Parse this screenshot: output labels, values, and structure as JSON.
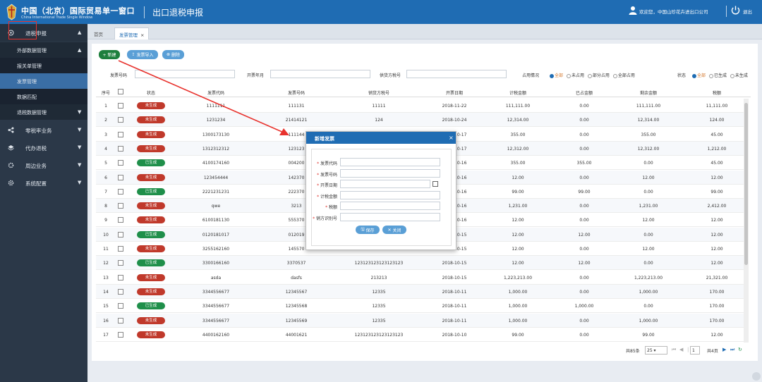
{
  "header": {
    "brand": "中国（北京）国际贸易单一窗口",
    "brand_sub": "China International Trade Single Window",
    "module": "出口退税申报",
    "welcome": "欢迎您，中国山珍花卉进出口公司",
    "logout": "退出"
  },
  "sidebar": {
    "items": [
      {
        "label": "退税申报",
        "icon": "settings-icon"
      },
      {
        "label": "外部数据管理"
      },
      {
        "label": "报关单管理"
      },
      {
        "label": "发票管理"
      },
      {
        "label": "数据匹配"
      },
      {
        "label": "退税数据管理"
      },
      {
        "label": "零税率业务",
        "icon": "share-icon"
      },
      {
        "label": "代办退税",
        "icon": "layers-icon"
      },
      {
        "label": "周边业务",
        "icon": "settings-icon"
      },
      {
        "label": "系统配置",
        "icon": "gear-icon"
      }
    ]
  },
  "tabs": {
    "home": "首页",
    "active": "发票管理"
  },
  "toolbar": {
    "add": "+ 新建",
    "import": "发票导入",
    "delete": "删除"
  },
  "filters": {
    "invoice_no": "发票号码",
    "issue_month": "开票年月",
    "seller_tax_no": "供货方税号",
    "occupy": "占用情况",
    "occupy_opts": [
      "全部",
      "未占用",
      "部分占用",
      "全部占用"
    ],
    "status": "状态",
    "status_opts": [
      "全部",
      "已生成",
      "未生成"
    ]
  },
  "table": {
    "headers": [
      "序号",
      "",
      "状态",
      "发票代码",
      "发票号码",
      "销货方税号",
      "开票日期",
      "计税金额",
      "已占金额",
      "剩余金额",
      "税额"
    ],
    "rows": [
      [
        "1",
        "未生成",
        "1111111",
        "111131",
        "11111",
        "2018-11-22",
        "111,111.00",
        "0.00",
        "111,111.00",
        "11,111.00"
      ],
      [
        "2",
        "未生成",
        "1231234",
        "21414121",
        "124",
        "2018-10-24",
        "12,314.00",
        "0.00",
        "12,314.00",
        "124.00"
      ],
      [
        "3",
        "未生成",
        "1300173130",
        "111144",
        "",
        "2018-10-17",
        "355.00",
        "0.00",
        "355.00",
        "45.00"
      ],
      [
        "4",
        "未生成",
        "1312312312",
        "123123",
        "",
        "2018-10-17",
        "12,312.00",
        "0.00",
        "12,312.00",
        "1,212.00"
      ],
      [
        "5",
        "已生成",
        "4100174160",
        "004200",
        "",
        "2018-10-16",
        "355.00",
        "355.00",
        "0.00",
        "45.00"
      ],
      [
        "6",
        "未生成",
        "123454444",
        "142370",
        "",
        "2018-10-16",
        "12.00",
        "0.00",
        "12.00",
        "12.00"
      ],
      [
        "7",
        "已生成",
        "2221231231",
        "222370",
        "",
        "2018-10-16",
        "99.00",
        "99.00",
        "0.00",
        "99.00"
      ],
      [
        "8",
        "未生成",
        "qwe",
        "3213",
        "",
        "2018-10-16",
        "1,231.00",
        "0.00",
        "1,231.00",
        "2,412.00"
      ],
      [
        "9",
        "未生成",
        "6100181130",
        "555370",
        "",
        "2018-10-16",
        "12.00",
        "0.00",
        "12.00",
        "12.00"
      ],
      [
        "10",
        "已生成",
        "0120181017",
        "012019",
        "",
        "2018-10-15",
        "12.00",
        "12.00",
        "0.00",
        "12.00"
      ],
      [
        "11",
        "未生成",
        "3255162160",
        "145570",
        "",
        "2018-10-15",
        "12.00",
        "0.00",
        "12.00",
        "12.00"
      ],
      [
        "12",
        "已生成",
        "3300166160",
        "3370537",
        "123123123123123123",
        "2018-10-15",
        "12.00",
        "12.00",
        "0.00",
        "12.00"
      ],
      [
        "13",
        "未生成",
        "asda",
        "dasfs",
        "213213",
        "2018-10-15",
        "1,223,213.00",
        "0.00",
        "1,223,213.00",
        "21,321.00"
      ],
      [
        "14",
        "未生成",
        "3344556677",
        "12345567",
        "12335",
        "2018-10-11",
        "1,000.00",
        "0.00",
        "1,000.00",
        "170.00"
      ],
      [
        "15",
        "已生成",
        "3344556677",
        "12345568",
        "12335",
        "2018-10-11",
        "1,000.00",
        "1,000.00",
        "0.00",
        "170.00"
      ],
      [
        "16",
        "未生成",
        "3344556677",
        "12345569",
        "12335",
        "2018-10-11",
        "1,000.00",
        "0.00",
        "1,000.00",
        "170.00"
      ],
      [
        "17",
        "未生成",
        "4400162160",
        "44001621",
        "123123123123123123",
        "2018-10-10",
        "99.00",
        "0.00",
        "99.00",
        "12.00"
      ]
    ]
  },
  "pagination": {
    "total": "共85条",
    "page_size": "25",
    "page": "1",
    "pages": "共4页"
  },
  "modal": {
    "title": "新增发票",
    "fields": [
      "发票代码",
      "发票号码",
      "开票日期",
      "计税金额",
      "税额",
      "销方识别号"
    ],
    "save": "保存",
    "close": "关闭"
  },
  "colors": {
    "primary": "#1f6cb3",
    "sidebar": "#2b3848",
    "green": "#1f8f4a",
    "red": "#c0392b",
    "highlight": "#e8322d"
  }
}
